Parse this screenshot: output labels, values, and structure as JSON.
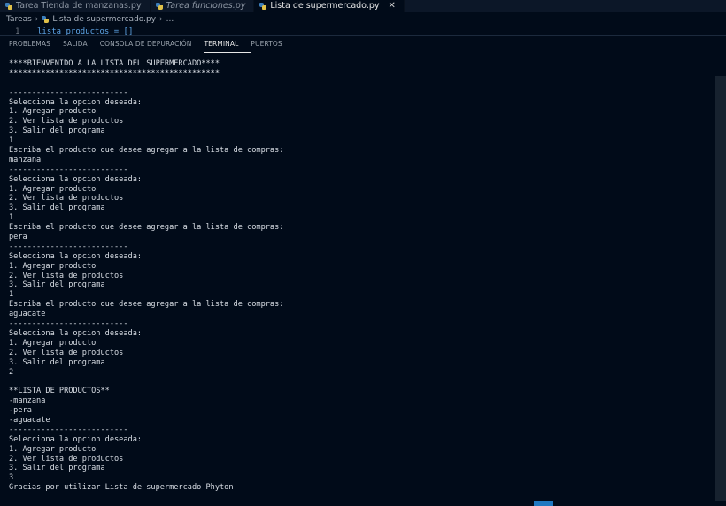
{
  "tabs": [
    {
      "label": "Tarea Tienda de manzanas.py",
      "italic": false,
      "active": false
    },
    {
      "label": "Tarea funciones.py",
      "italic": true,
      "active": false
    },
    {
      "label": "Lista de supermercado.py",
      "italic": false,
      "active": true
    }
  ],
  "breadcrumb": {
    "folder": "Tareas",
    "file": "Lista de supermercado.py",
    "more": "..."
  },
  "editor": {
    "line_number": "1",
    "code": "lista_productos = []"
  },
  "panel_tabs": [
    "PROBLEMAS",
    "SALIDA",
    "CONSOLA DE DEPURACIÓN",
    "TERMINAL",
    "PUERTOS"
  ],
  "panel_active_tab": "TERMINAL",
  "terminal_lines": [
    "****BIENVENIDO A LA LISTA DEL SUPERMERCADO****",
    "**********************************************",
    "",
    "--------------------------",
    "Selecciona la opcion deseada:",
    "1. Agregar producto",
    "2. Ver lista de productos",
    "3. Salir del programa",
    "1",
    "Escriba el producto que desee agregar a la lista de compras:",
    "manzana",
    "--------------------------",
    "Selecciona la opcion deseada:",
    "1. Agregar producto",
    "2. Ver lista de productos",
    "3. Salir del programa",
    "1",
    "Escriba el producto que desee agregar a la lista de compras:",
    "pera",
    "--------------------------",
    "Selecciona la opcion deseada:",
    "1. Agregar producto",
    "2. Ver lista de productos",
    "3. Salir del programa",
    "1",
    "Escriba el producto que desee agregar a la lista de compras:",
    "aguacate",
    "--------------------------",
    "Selecciona la opcion deseada:",
    "1. Agregar producto",
    "2. Ver lista de productos",
    "3. Salir del programa",
    "2",
    "",
    "**LISTA DE PRODUCTOS**",
    "-manzana",
    "-pera",
    "-aguacate",
    "--------------------------",
    "Selecciona la opcion deseada:",
    "1. Agregar producto",
    "2. Ver lista de productos",
    "3. Salir del programa",
    "3",
    "Gracias por utilizar Lista de supermercado Phyton"
  ],
  "colors": {
    "background": "#010b19",
    "accent": "#1f78c1"
  },
  "icons": [
    "python-file-icon",
    "close-icon",
    "chevron-right-icon"
  ]
}
